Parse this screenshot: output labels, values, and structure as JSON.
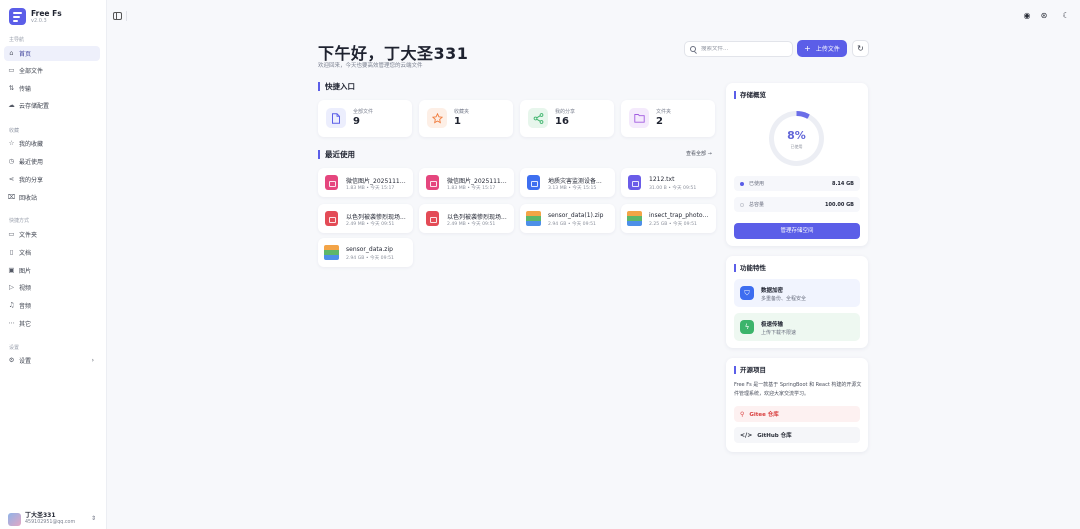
{
  "app": {
    "name": "Free Fs",
    "version": "v2.0.3"
  },
  "sidebar": {
    "sections": [
      {
        "title": "主导航",
        "items": [
          {
            "label": "首页",
            "icon": "home-icon",
            "active": true
          },
          {
            "label": "全部文件",
            "icon": "folder-icon"
          },
          {
            "label": "传输",
            "icon": "transfer-icon"
          },
          {
            "label": "云存储配置",
            "icon": "cloud-storage-icon"
          }
        ]
      },
      {
        "title": "收藏",
        "items": [
          {
            "label": "我的收藏",
            "icon": "star-icon"
          },
          {
            "label": "最近使用",
            "icon": "clock-icon"
          },
          {
            "label": "我的分享",
            "icon": "share-icon"
          },
          {
            "label": "回收站",
            "icon": "trash-icon"
          }
        ]
      },
      {
        "title": "快捷方式",
        "items": [
          {
            "label": "文件夹",
            "icon": "folder-icon"
          },
          {
            "label": "文档",
            "icon": "document-icon"
          },
          {
            "label": "图片",
            "icon": "image-icon"
          },
          {
            "label": "视频",
            "icon": "video-icon"
          },
          {
            "label": "音频",
            "icon": "music-icon"
          },
          {
            "label": "其它",
            "icon": "more-icon"
          }
        ]
      },
      {
        "title": "设置",
        "items": [
          {
            "label": "设置",
            "icon": "gear-icon"
          }
        ]
      }
    ],
    "user": {
      "name": "丁大圣331",
      "email": "459102951@qq.com"
    }
  },
  "header": {
    "greeting": "下午好，丁大圣331",
    "subtitle": "欢迎回来，今天也要高效管理您的云端文件",
    "search_placeholder": "搜索文件...",
    "upload_label": "上传文件"
  },
  "quick_access": {
    "title": "快捷入口",
    "stats": [
      {
        "label": "全部文件",
        "value": "9",
        "icon": "file-icon",
        "color": "#5b5ee8",
        "bg": "#eceefd"
      },
      {
        "label": "收藏夹",
        "value": "1",
        "icon": "star-icon",
        "color": "#f07a3a",
        "bg": "#fdefe6"
      },
      {
        "label": "我的分享",
        "value": "16",
        "icon": "share-icon",
        "color": "#3cb46b",
        "bg": "#e7f6ec"
      },
      {
        "label": "文件夹",
        "value": "2",
        "icon": "folder-icon",
        "color": "#a15be0",
        "bg": "#f4eafc"
      }
    ]
  },
  "recent": {
    "title": "最近使用",
    "see_all": "查看全部 →",
    "files": [
      {
        "name": "微信图片_20251117...",
        "meta": "1.83 MB • 今天 15:17",
        "type": "img"
      },
      {
        "name": "微信图片_20251117...",
        "meta": "1.83 MB • 今天 15:17",
        "type": "img"
      },
      {
        "name": "地质灾害监测设备...",
        "meta": "3.13 MB • 今天 15:15",
        "type": "doc"
      },
      {
        "name": "1212.txt",
        "meta": "31.00 B • 今天 09:51",
        "type": "txt"
      },
      {
        "name": "以色列被袭惨烈现场...",
        "meta": "2.49 MB • 今天 09:51",
        "type": "pdf"
      },
      {
        "name": "以色列被袭惨烈现场...",
        "meta": "2.49 MB • 今天 09:51",
        "type": "pdf"
      },
      {
        "name": "sensor_data(1).zip",
        "meta": "2.94 GB • 今天 09:51",
        "type": "zip"
      },
      {
        "name": "insect_trap_photos...",
        "meta": "2.25 GB • 今天 09:51",
        "type": "zip"
      },
      {
        "name": "sensor_data.zip",
        "meta": "2.94 GB • 今天 09:51",
        "type": "zip"
      }
    ]
  },
  "storage": {
    "title": "存储概览",
    "percent_label": "8%",
    "percent_value": 0.08,
    "used_caption": "已使用",
    "used_label": "已使用",
    "used_value": "8.14 GB",
    "total_label": "总容量",
    "total_value": "100.00 GB",
    "manage_label": "管理存储空间"
  },
  "features": {
    "title": "功能特性",
    "items": [
      {
        "title": "数据加密",
        "desc": "多重备份、全程安全",
        "icon": "shield-icon",
        "color": "#3d6df0",
        "bg": "#f1f4fe"
      },
      {
        "title": "极速传输",
        "desc": "上传下载不限速",
        "icon": "lightning-icon",
        "color": "#3cb46b",
        "bg": "#eef8f1"
      }
    ]
  },
  "opensource": {
    "title": "开源项目",
    "desc": "Free Fs 是一款基于 SpringBoot 和 React 构建的开源文件管理系统，欢迎大家交流学习。",
    "gitee_label": "Gitee 仓库",
    "github_label": "GitHub 仓库"
  }
}
